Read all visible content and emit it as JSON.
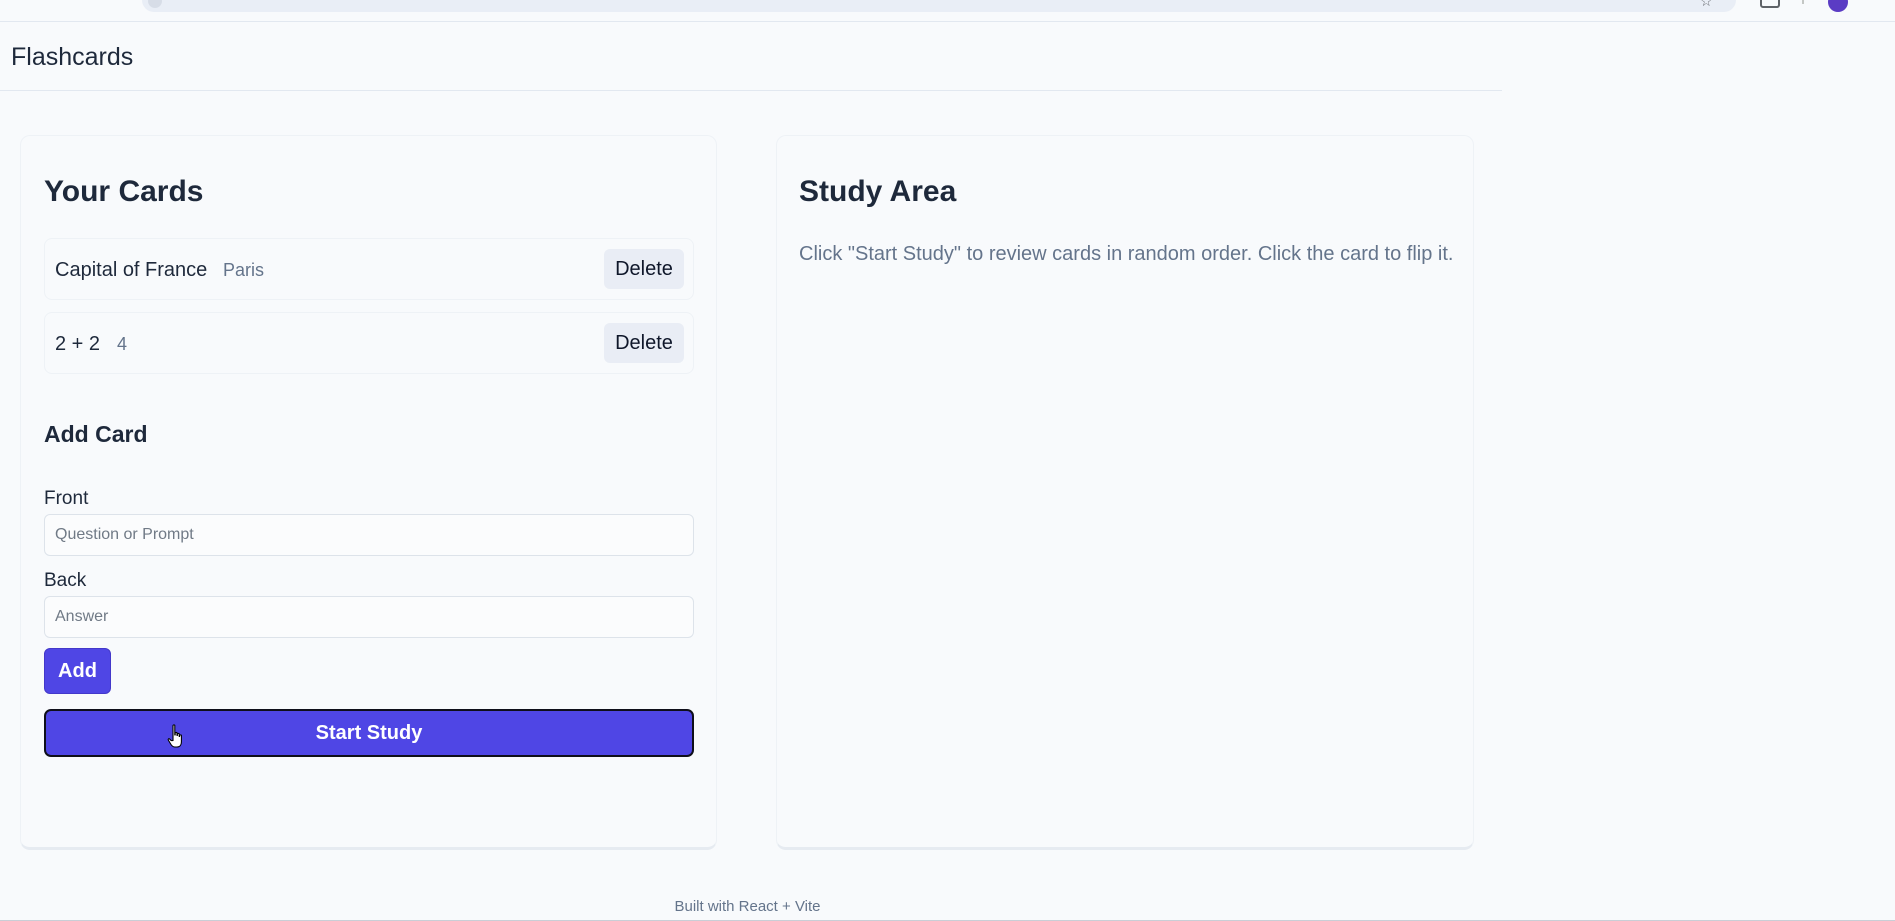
{
  "app": {
    "title": "Flashcards",
    "footer": "Built with React + Vite"
  },
  "cards_panel": {
    "heading": "Your Cards",
    "cards": [
      {
        "front": "Capital of France",
        "back": "Paris",
        "delete_label": "Delete"
      },
      {
        "front": "2 + 2",
        "back": "4",
        "delete_label": "Delete"
      }
    ]
  },
  "add_card": {
    "heading": "Add Card",
    "front_label": "Front",
    "front_placeholder": "Question or Prompt",
    "front_value": "",
    "back_label": "Back",
    "back_placeholder": "Answer",
    "back_value": "",
    "add_label": "Add",
    "start_label": "Start Study"
  },
  "study_panel": {
    "heading": "Study Area",
    "description": "Click \"Start Study\" to review cards in random order. Click the card to flip it."
  },
  "colors": {
    "accent": "#4f46e5",
    "background": "#f8fafc",
    "text": "#1e293b",
    "muted": "#64748b"
  },
  "icons": {
    "cursor": "hand-pointer-icon",
    "bookmark": "star-icon",
    "extensions": "extensions-icon",
    "profile": "profile-avatar"
  }
}
